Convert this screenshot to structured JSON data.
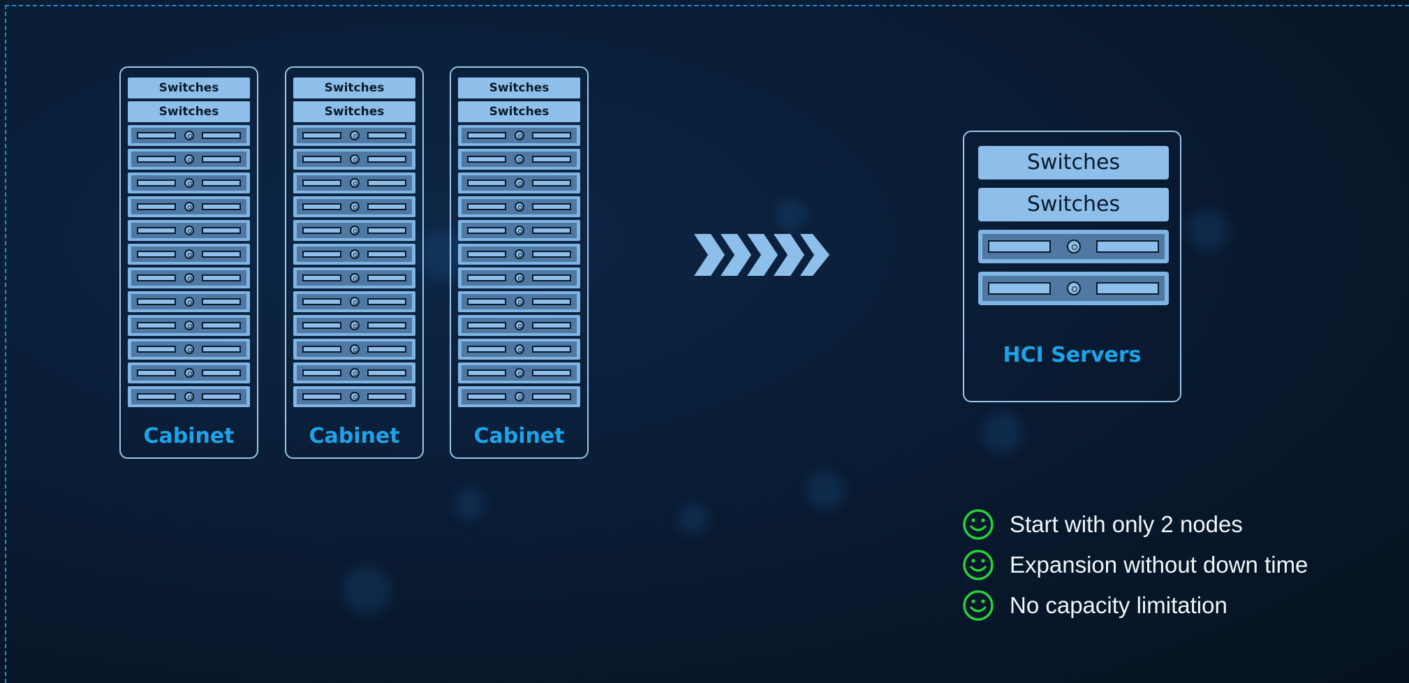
{
  "cabinets": [
    {
      "switches": [
        "Switches",
        "Switches"
      ],
      "server_count": 12,
      "label": "Cabinet"
    },
    {
      "switches": [
        "Switches",
        "Switches"
      ],
      "server_count": 12,
      "label": "Cabinet"
    },
    {
      "switches": [
        "Switches",
        "Switches"
      ],
      "server_count": 12,
      "label": "Cabinet"
    }
  ],
  "arrow": {
    "icon": "chevron-arrows-icon",
    "chevron_count": 5,
    "color": "#8ebfea"
  },
  "hci": {
    "switches": [
      "Switches",
      "Switches"
    ],
    "server_count": 2,
    "label": "HCI Servers"
  },
  "benefits": [
    {
      "icon": "smiley-icon",
      "text": "Start with only 2 nodes"
    },
    {
      "icon": "smiley-icon",
      "text": "Expansion without down time"
    },
    {
      "icon": "smiley-icon",
      "text": "No capacity limitation"
    }
  ],
  "colors": {
    "background": "#0a1d36",
    "accent_text": "#1fa3e8",
    "rack_unit": "#8ebfea",
    "smiley": "#2ad03a",
    "frame_dash": "#1c8fd2"
  }
}
